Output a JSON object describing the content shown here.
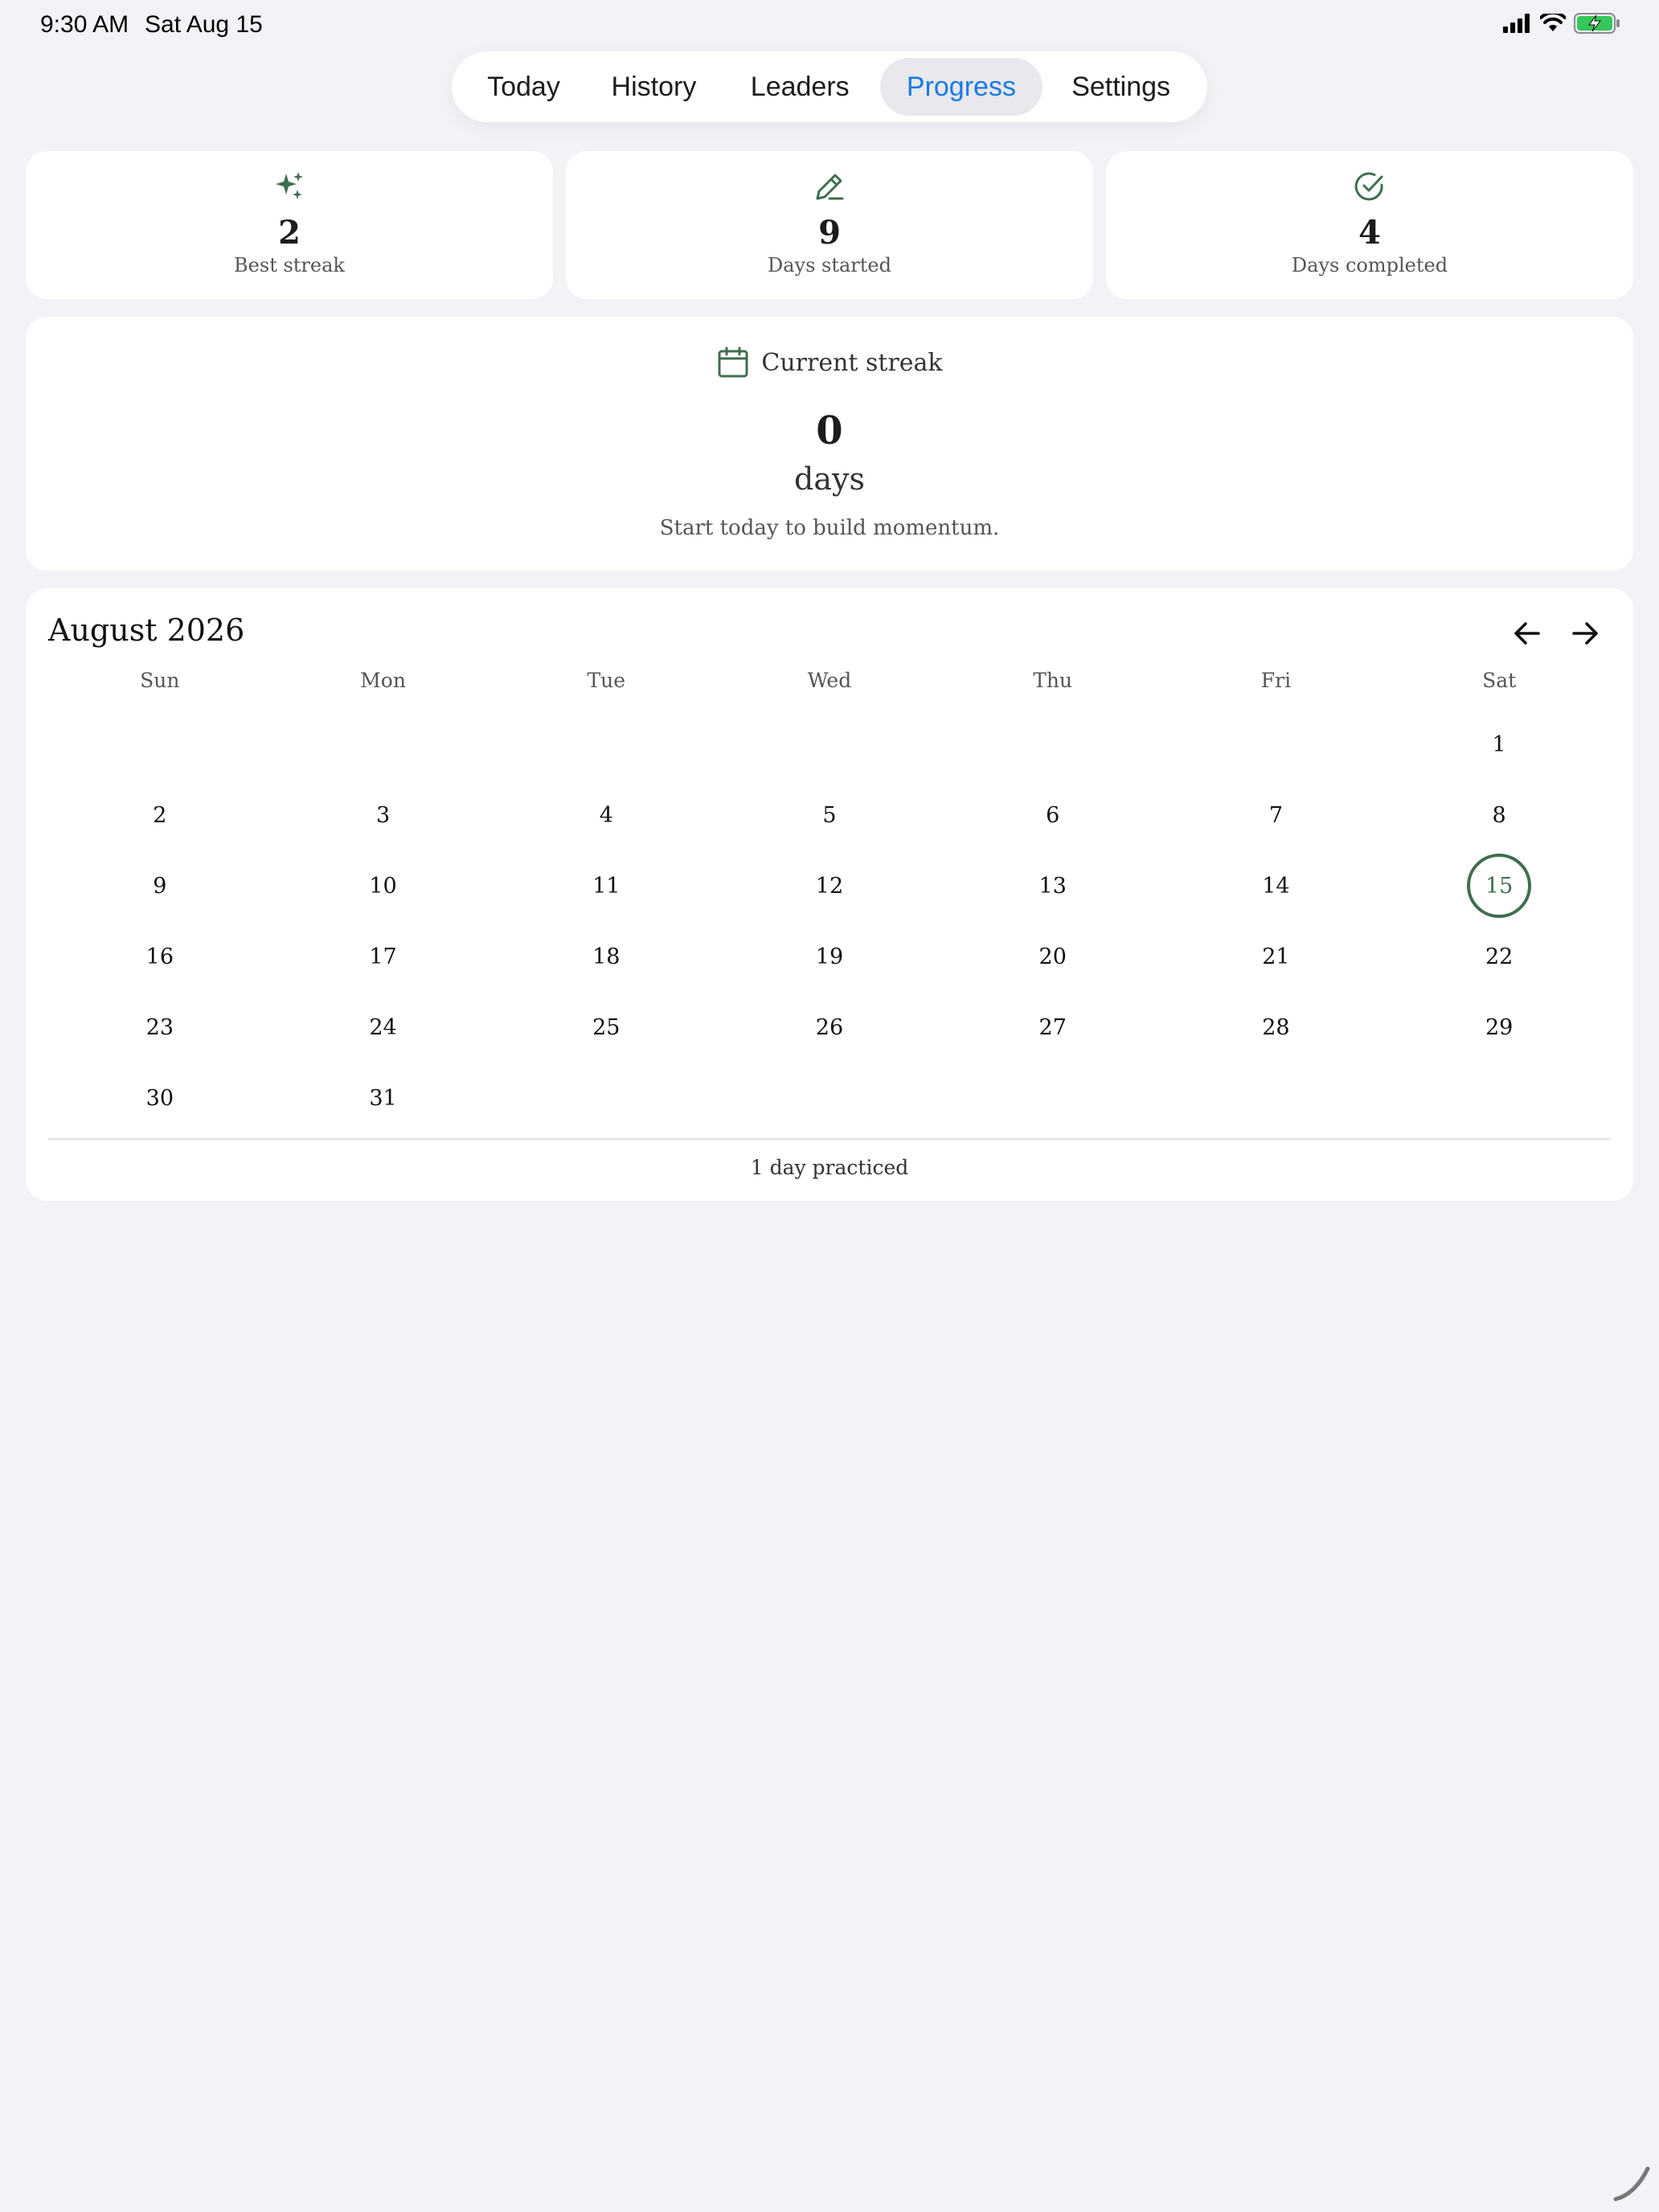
{
  "status_bar": {
    "time": "9:30 AM",
    "date": "Sat Aug 15",
    "icons": [
      "cellular-signal-icon",
      "wifi-icon",
      "battery-charging-icon"
    ]
  },
  "tabs": [
    {
      "label": "Today",
      "active": false
    },
    {
      "label": "History",
      "active": false
    },
    {
      "label": "Leaders",
      "active": false
    },
    {
      "label": "Progress",
      "active": true
    },
    {
      "label": "Settings",
      "active": false
    }
  ],
  "stats": [
    {
      "icon": "sparkles-icon",
      "value": "2",
      "label": "Best streak"
    },
    {
      "icon": "pencil-icon",
      "value": "9",
      "label": "Days started"
    },
    {
      "icon": "check-circle-icon",
      "value": "4",
      "label": "Days completed"
    }
  ],
  "current_streak": {
    "icon": "calendar-icon",
    "label": "Current streak",
    "value": "0",
    "unit": "days",
    "message": "Start today to build momentum."
  },
  "calendar": {
    "title": "August 2026",
    "weekdays": [
      "Sun",
      "Mon",
      "Tue",
      "Wed",
      "Thu",
      "Fri",
      "Sat"
    ],
    "leading_blanks": 6,
    "days": [
      "1",
      "2",
      "3",
      "4",
      "5",
      "6",
      "7",
      "8",
      "9",
      "10",
      "11",
      "12",
      "13",
      "14",
      "15",
      "16",
      "17",
      "18",
      "19",
      "20",
      "21",
      "22",
      "23",
      "24",
      "25",
      "26",
      "27",
      "28",
      "29",
      "30",
      "31"
    ],
    "today": "15",
    "summary": "1 day practiced"
  },
  "colors": {
    "accent_green": "#3f6e4e",
    "active_tab_text": "#1a7ae0",
    "background": "#f2f2f7"
  }
}
